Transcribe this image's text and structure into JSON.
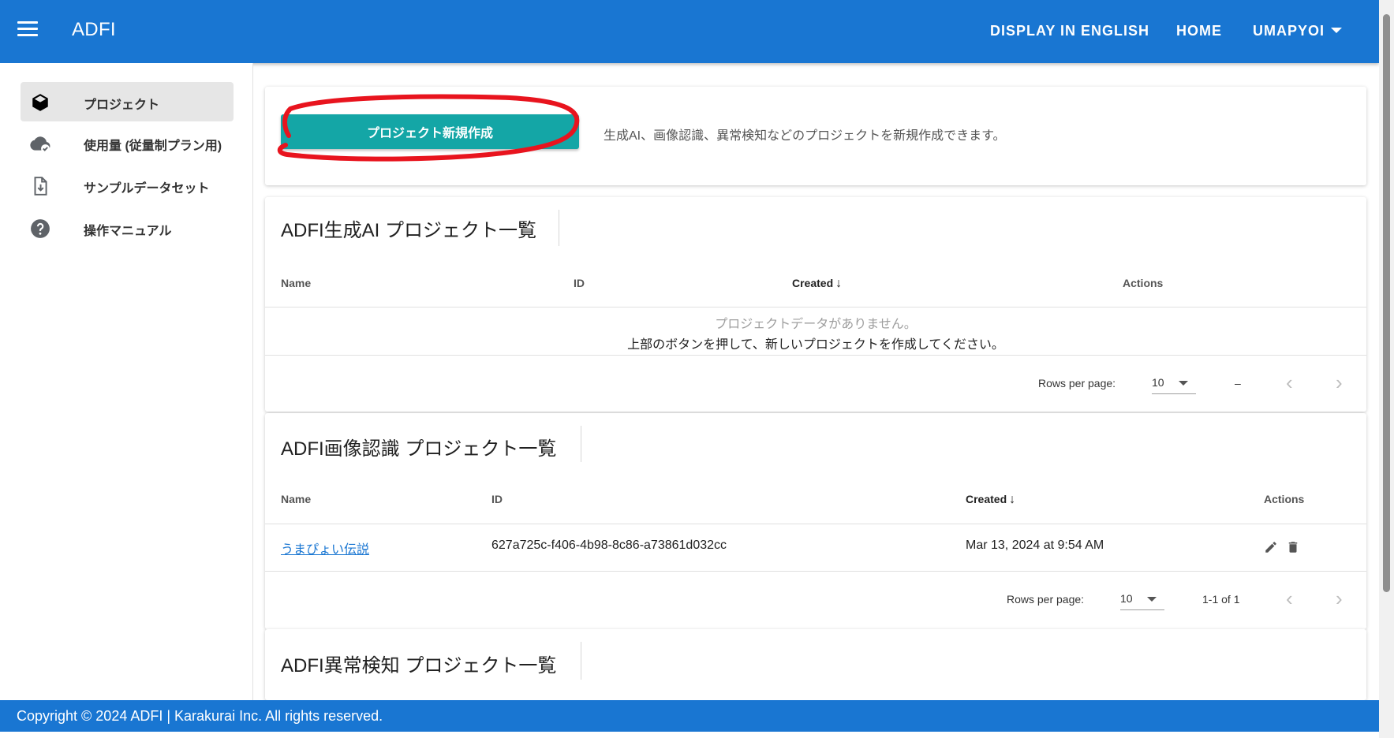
{
  "header": {
    "app_title": "ADFI",
    "nav_english": "DISPLAY IN ENGLISH",
    "nav_home": "HOME",
    "nav_user": "UMAPYOI"
  },
  "sidebar": {
    "items": [
      {
        "label": "プロジェクト",
        "icon": "cube-icon",
        "active": true
      },
      {
        "label": "使用量 (従量制プラン用)",
        "icon": "cloud-check-icon",
        "active": false
      },
      {
        "label": "サンプルデータセット",
        "icon": "file-download-icon",
        "active": false
      },
      {
        "label": "操作マニュアル",
        "icon": "help-circle-icon",
        "active": false
      }
    ]
  },
  "create": {
    "button_label": "プロジェクト新規作成",
    "description": "生成AI、画像認識、異常検知などのプロジェクトを新規作成できます。"
  },
  "sections": {
    "genai": {
      "title": "ADFI生成AI プロジェクト一覧",
      "columns": {
        "name": "Name",
        "id": "ID",
        "created": "Created",
        "actions": "Actions"
      },
      "empty_line1": "プロジェクトデータがありません。",
      "empty_line2": "上部のボタンを押して、新しいプロジェクトを作成してください。",
      "rows_per_page_label": "Rows per page:",
      "rows_per_page": "10",
      "range": "–"
    },
    "image": {
      "title": "ADFI画像認識 プロジェクト一覧",
      "columns": {
        "name": "Name",
        "id": "ID",
        "created": "Created",
        "actions": "Actions"
      },
      "rows": [
        {
          "name": "うまぴょい伝説",
          "id": "627a725c-f406-4b98-8c86-a73861d032cc",
          "created": "Mar 13, 2024 at 9:54 AM"
        }
      ],
      "rows_per_page_label": "Rows per page:",
      "rows_per_page": "10",
      "range": "1-1 of 1"
    },
    "anomaly": {
      "title": "ADFI異常検知 プロジェクト一覧"
    }
  },
  "footer": {
    "text": "Copyright © 2024 ADFI | Karakurai Inc. All rights reserved."
  },
  "colors": {
    "primary": "#1976d2",
    "create_button": "#14a6a6",
    "annotation_ring": "#e8141e"
  }
}
